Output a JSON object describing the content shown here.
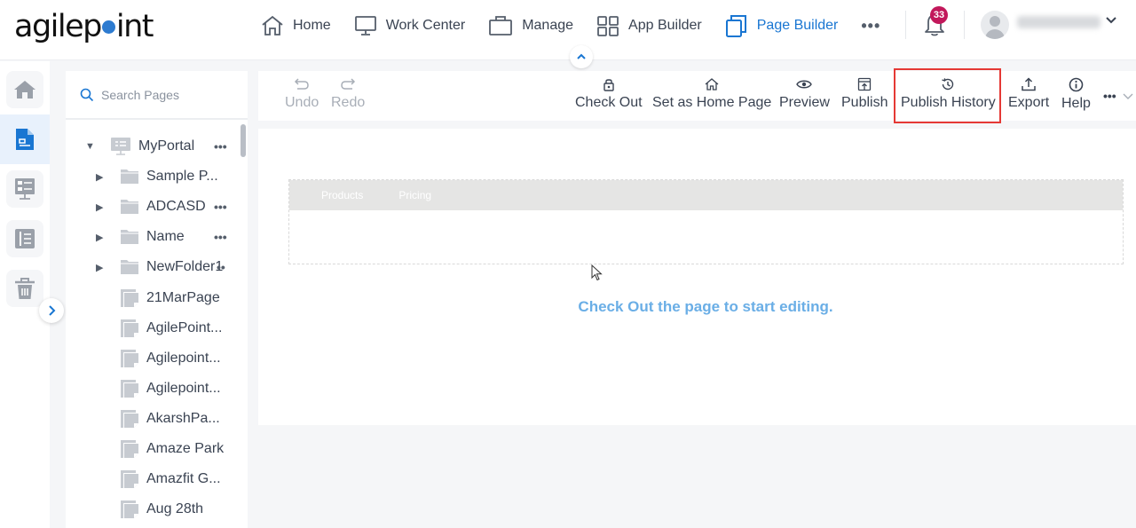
{
  "app": {
    "logo_text_left": "agilep",
    "logo_text_right": "int",
    "brand_color": "#2d7bd0",
    "accent_color": "#1976d2",
    "highlight_color": "#e53935"
  },
  "nav": {
    "items": [
      {
        "label": "Home",
        "icon": "home-icon"
      },
      {
        "label": "Work Center",
        "icon": "monitor-icon"
      },
      {
        "label": "Manage",
        "icon": "briefcase-icon"
      },
      {
        "label": "App Builder",
        "icon": "grid-icon"
      },
      {
        "label": "Page Builder",
        "icon": "pages-icon",
        "active": true
      }
    ],
    "more_label": "•••",
    "notifications_count": "33",
    "user_name": "(blurred user name)"
  },
  "rail": {
    "items": [
      {
        "name": "home",
        "icon": "home-icon"
      },
      {
        "name": "pages",
        "icon": "page-icon",
        "active": true
      },
      {
        "name": "portal",
        "icon": "portal-icon"
      },
      {
        "name": "list",
        "icon": "list-icon"
      },
      {
        "name": "trash",
        "icon": "trash-icon"
      }
    ]
  },
  "tree": {
    "search_placeholder": "Search Pages",
    "root": {
      "label": "MyPortal",
      "more": "•••"
    },
    "folders": [
      {
        "label": "Sample P...",
        "more": ""
      },
      {
        "label": "ADCASD",
        "more": "•••"
      },
      {
        "label": "Name",
        "more": "•••"
      },
      {
        "label": "NewFolder1",
        "more": "••"
      }
    ],
    "pages": [
      {
        "label": "21MarPage"
      },
      {
        "label": "AgilePoint..."
      },
      {
        "label": "Agilepoint..."
      },
      {
        "label": "Agilepoint..."
      },
      {
        "label": "AkarshPa..."
      },
      {
        "label": "Amaze Park"
      },
      {
        "label": "Amazfit G..."
      },
      {
        "label": "Aug 28th"
      }
    ]
  },
  "toolbar": {
    "undo": "Undo",
    "redo": "Redo",
    "check_out": "Check Out",
    "set_home": "Set as Home Page",
    "preview": "Preview",
    "publish": "Publish",
    "publish_history": "Publish History",
    "export": "Export",
    "help": "Help",
    "more": "•••"
  },
  "canvas": {
    "menu_items": [
      "Products",
      "Pricing"
    ],
    "message": "Check Out the page to start editing."
  }
}
